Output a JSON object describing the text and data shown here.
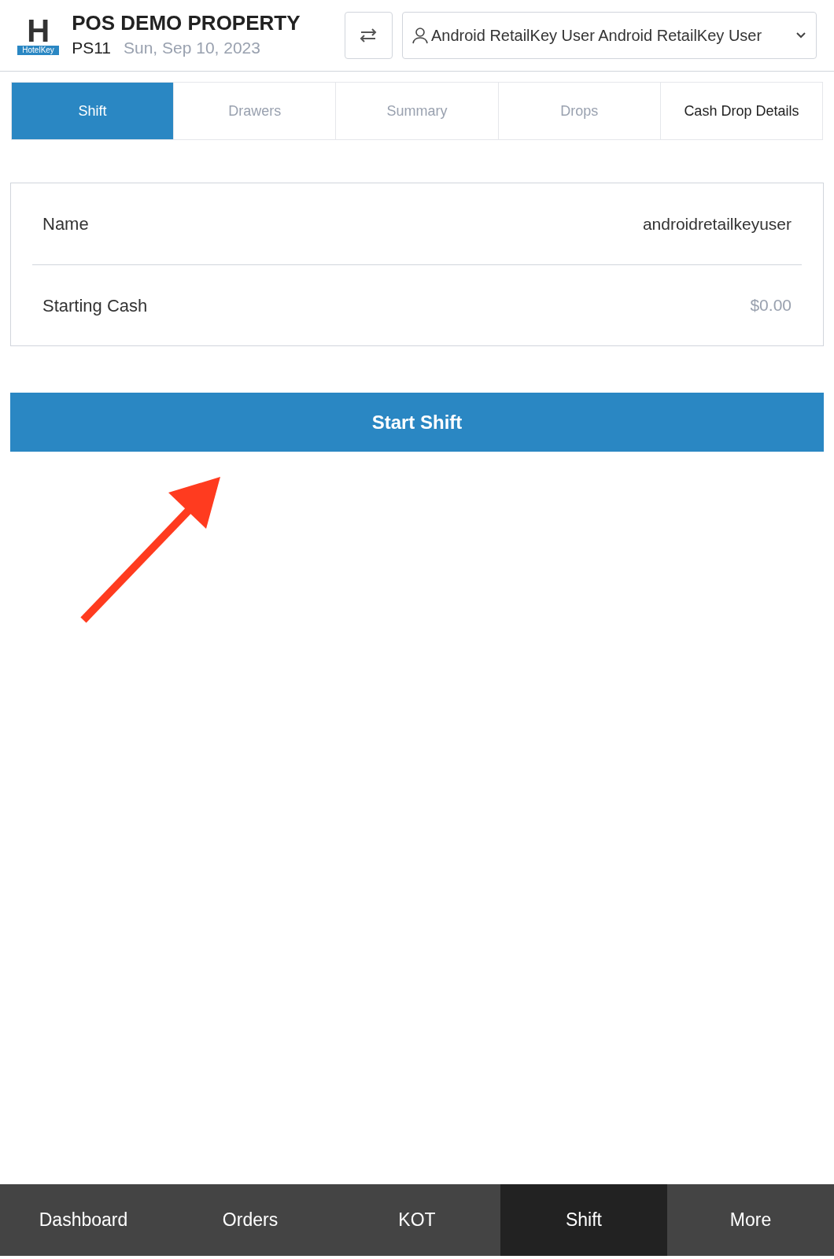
{
  "header": {
    "logo": {
      "letter": "H",
      "caption": "HotelKey"
    },
    "property": "POS DEMO PROPERTY",
    "station": "PS11",
    "date": "Sun, Sep 10, 2023",
    "user": "Android RetailKey User Android RetailKey User"
  },
  "tabs": [
    {
      "label": "Shift",
      "selected": true,
      "disabled": false
    },
    {
      "label": "Drawers",
      "selected": false,
      "disabled": true
    },
    {
      "label": "Summary",
      "selected": false,
      "disabled": true
    },
    {
      "label": "Drops",
      "selected": false,
      "disabled": true
    },
    {
      "label": "Cash Drop Details",
      "selected": false,
      "disabled": false
    }
  ],
  "fields": [
    {
      "label": "Name",
      "value": "androidretailkeyuser",
      "kind": "text"
    },
    {
      "label": "Starting Cash",
      "placeholder": "$0.00",
      "kind": "input"
    }
  ],
  "primary_button": "Start Shift",
  "bottom_nav": [
    {
      "label": "Dashboard",
      "selected": false
    },
    {
      "label": "Orders",
      "selected": false
    },
    {
      "label": "KOT",
      "selected": false
    },
    {
      "label": "Shift",
      "selected": true
    },
    {
      "label": "More",
      "selected": false
    }
  ]
}
